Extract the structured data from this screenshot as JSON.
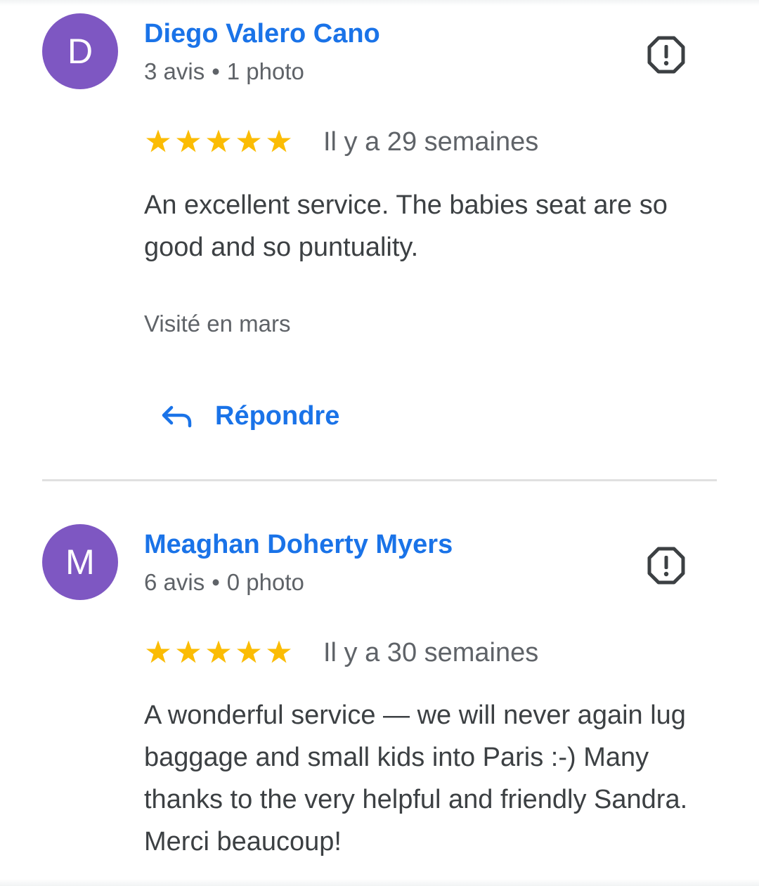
{
  "colors": {
    "link_blue": "#1a73e8",
    "star_yellow": "#fbbc04",
    "avatar_purple": "#7e57c2",
    "secondary_text": "#5f6368",
    "body_text": "#3c4043"
  },
  "reviews": [
    {
      "avatar_letter": "D",
      "author": "Diego Valero Cano",
      "review_count": "3 avis",
      "separator": "•",
      "photo_count": "1 photo",
      "rating": 5,
      "date": "Il y a 29 semaines",
      "text": "An excellent service. The babies seat are so good and so puntuality.",
      "visited": "Visité en mars",
      "reply_label": "Répondre",
      "flag_icon": "report-flag-icon"
    },
    {
      "avatar_letter": "M",
      "author": "Meaghan Doherty Myers",
      "review_count": "6 avis",
      "separator": "•",
      "photo_count": "0 photo",
      "rating": 5,
      "date": "Il y a 30 semaines",
      "text": "A wonderful service — we will never again lug baggage and small kids into Paris :-) Many thanks to the very helpful and friendly Sandra. Merci beaucoup!",
      "flag_icon": "report-flag-icon"
    }
  ]
}
